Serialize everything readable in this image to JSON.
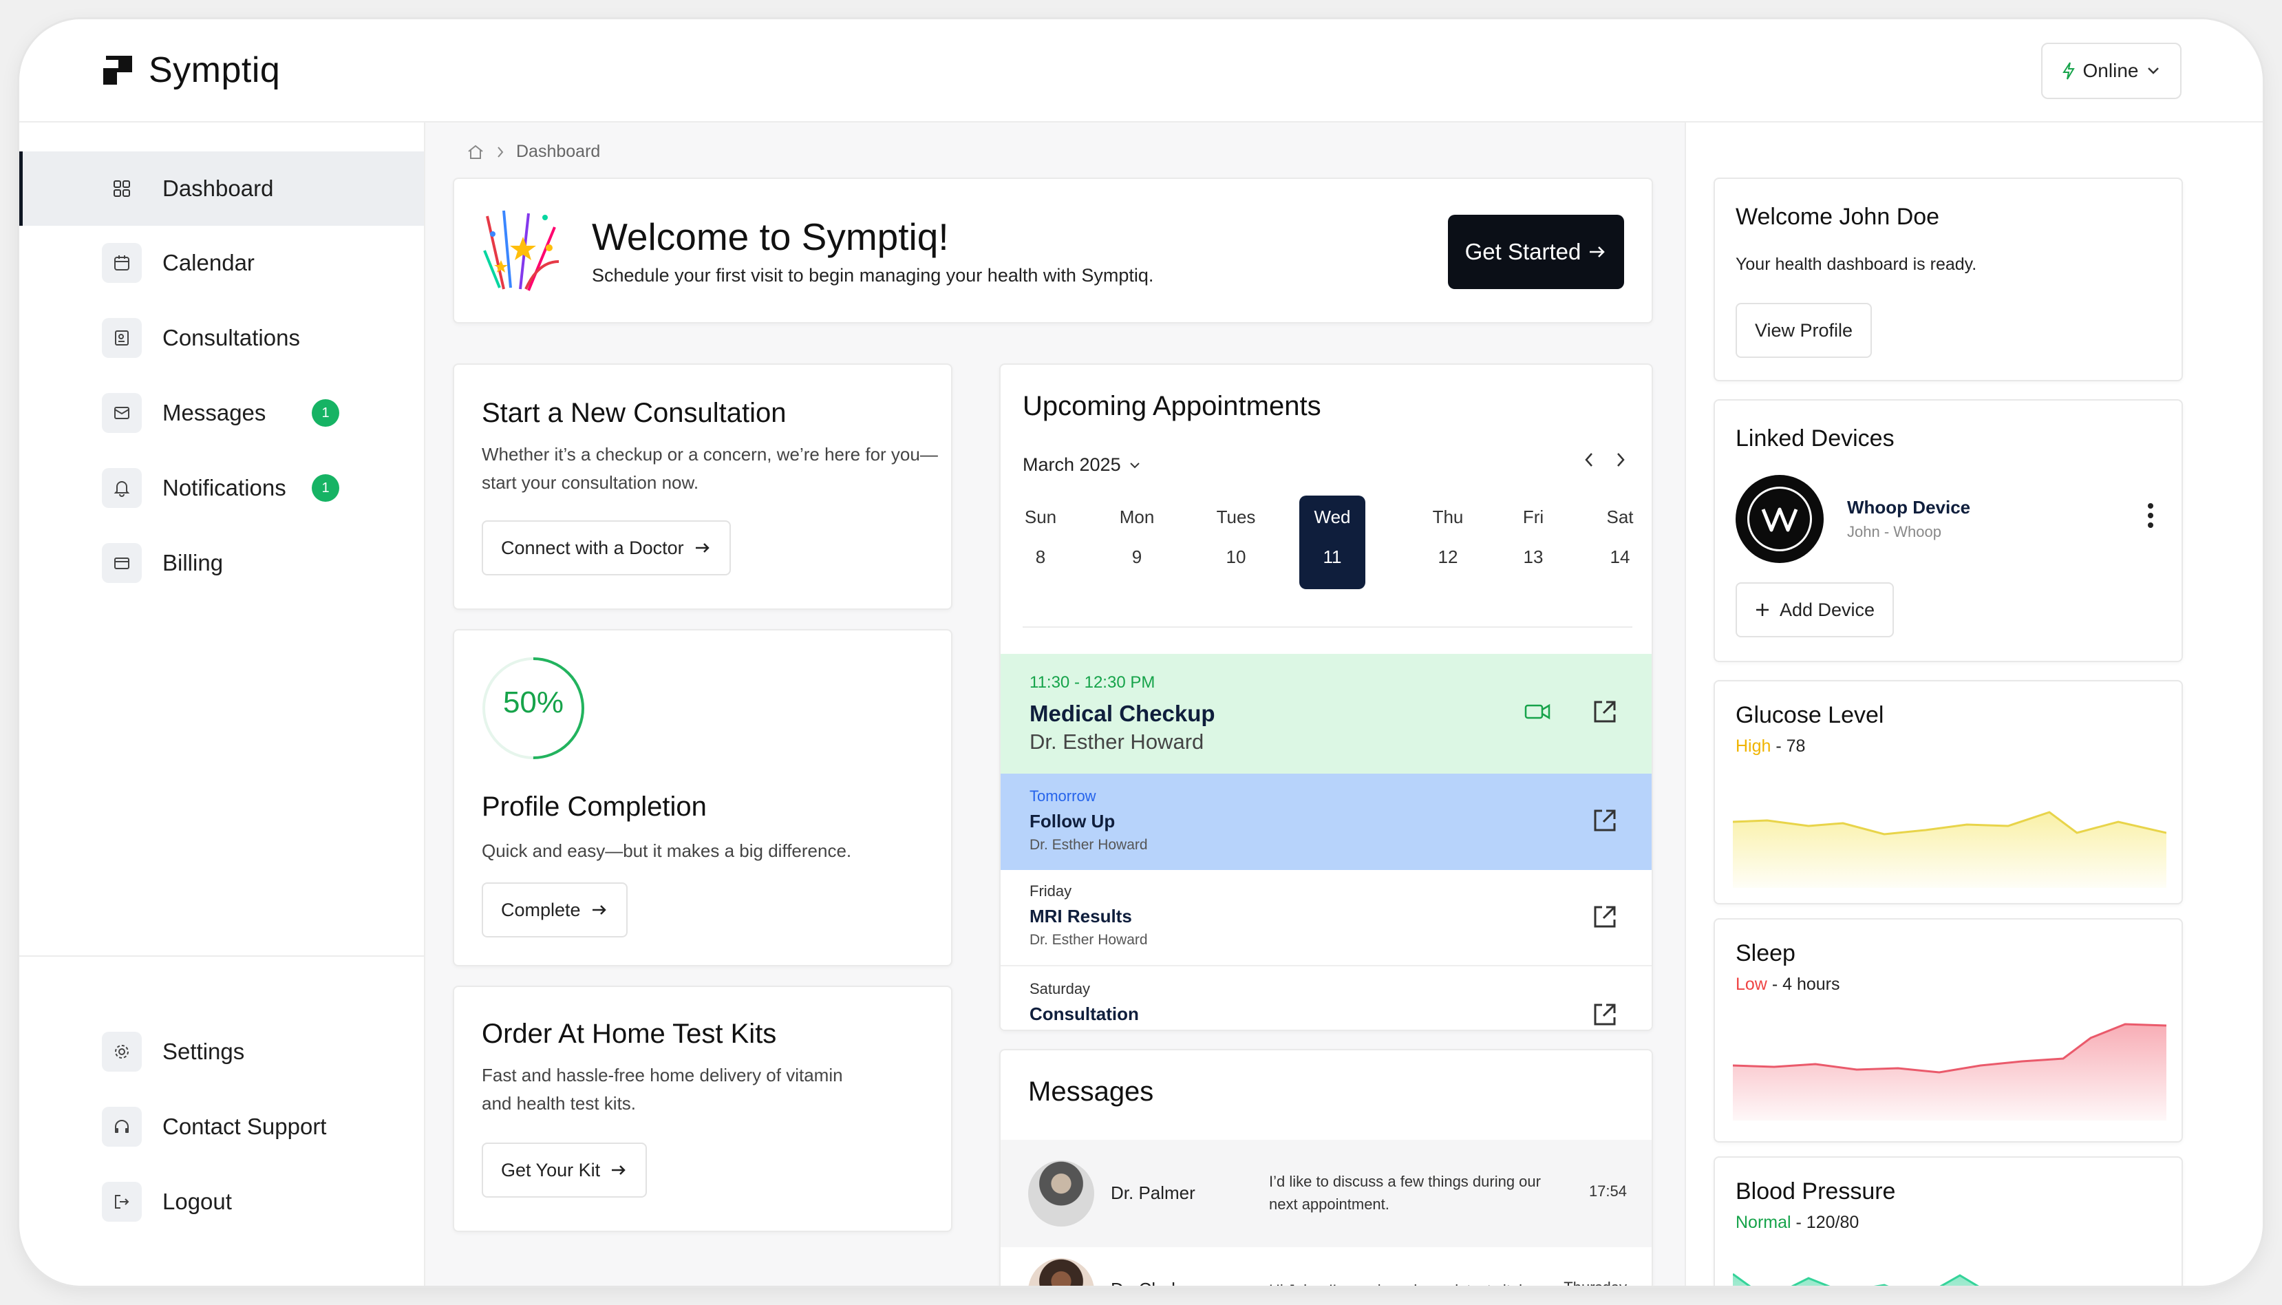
{
  "app": {
    "name": "Symptiq"
  },
  "header": {
    "status_label": "Online"
  },
  "sidebar": {
    "items": [
      {
        "label": "Dashboard",
        "icon": "grid-icon"
      },
      {
        "label": "Calendar",
        "icon": "calendar-icon"
      },
      {
        "label": "Consultations",
        "icon": "consultation-icon"
      },
      {
        "label": "Messages",
        "icon": "mail-icon",
        "badge": "1"
      },
      {
        "label": "Notifications",
        "icon": "bell-icon",
        "badge": "1"
      },
      {
        "label": "Billing",
        "icon": "card-icon"
      }
    ],
    "bottom_items": [
      {
        "label": "Settings",
        "icon": "gear-icon"
      },
      {
        "label": "Contact Support",
        "icon": "headset-icon"
      },
      {
        "label": "Logout",
        "icon": "logout-icon"
      }
    ]
  },
  "breadcrumb": {
    "current": "Dashboard"
  },
  "welcome": {
    "title": "Welcome to Symptiq!",
    "subtitle": "Schedule your first visit to begin managing your health with Symptiq.",
    "cta": "Get Started"
  },
  "consultation": {
    "title": "Start a New Consultation",
    "line1": "Whether it’s a checkup or a concern, we’re here for you—",
    "line2": "start your consultation now.",
    "button": "Connect with a Doctor"
  },
  "profile": {
    "percent_label": "50%",
    "progress": 0.5,
    "title": "Profile Completion",
    "subtitle": "Quick and easy—but it makes a big difference.",
    "button": "Complete"
  },
  "testkits": {
    "title": "Order At Home Test Kits",
    "line1": "Fast and hassle-free home delivery of vitamin",
    "line2": "and health test kits.",
    "button": "Get Your Kit"
  },
  "appointments": {
    "title": "Upcoming Appointments",
    "month": "March 2025",
    "days": [
      {
        "name": "Sun",
        "date": "8"
      },
      {
        "name": "Mon",
        "date": "9"
      },
      {
        "name": "Tues",
        "date": "10"
      },
      {
        "name": "Wed",
        "date": "11"
      },
      {
        "name": "Thu",
        "date": "12"
      },
      {
        "name": "Fri",
        "date": "13"
      },
      {
        "name": "Sat",
        "date": "14"
      }
    ],
    "items": [
      {
        "time": "11:30 - 12:30 PM",
        "title": "Medical Checkup",
        "doctor": "Dr. Esther Howard"
      },
      {
        "time": "Tomorrow",
        "title": "Follow Up",
        "doctor": "Dr. Esther Howard"
      },
      {
        "time": "Friday",
        "title": "MRI Results",
        "doctor": "Dr. Esther Howard"
      },
      {
        "time": "Saturday",
        "title": "Consultation",
        "doctor": ""
      }
    ]
  },
  "messages": {
    "title": "Messages",
    "items": [
      {
        "name": "Dr. Palmer",
        "line1": "I’d like to discuss a few things during our",
        "line2": "next appointment.",
        "time": "17:54"
      },
      {
        "name": "Dr. Chohan",
        "line1": "Hi John, I’ve reviewed your latest vitals",
        "line2": "",
        "time": "Thursday"
      }
    ]
  },
  "profile_card": {
    "title": "Welcome John Doe",
    "subtitle": "Your health dashboard is ready.",
    "button": "View Profile"
  },
  "devices": {
    "title": "Linked Devices",
    "device_name": "Whoop Device",
    "device_sub": "John - Whoop",
    "add_button": "Add Device"
  },
  "glucose": {
    "title": "Glucose Level",
    "status": "High",
    "value": " - 78",
    "color": "#f0b400"
  },
  "sleep": {
    "title": "Sleep",
    "status": "Low",
    "value": " - 4 hours",
    "color": "#ef4444"
  },
  "blood_pressure": {
    "title": "Blood Pressure",
    "status": "Normal",
    "value": " - 120/80",
    "color": "#16a34a"
  },
  "colors": {
    "accent_dark": "#0b0f17",
    "green_badge": "#16b364",
    "appt_green": "#dcf7e4",
    "appt_blue": "#b7d3fb"
  }
}
